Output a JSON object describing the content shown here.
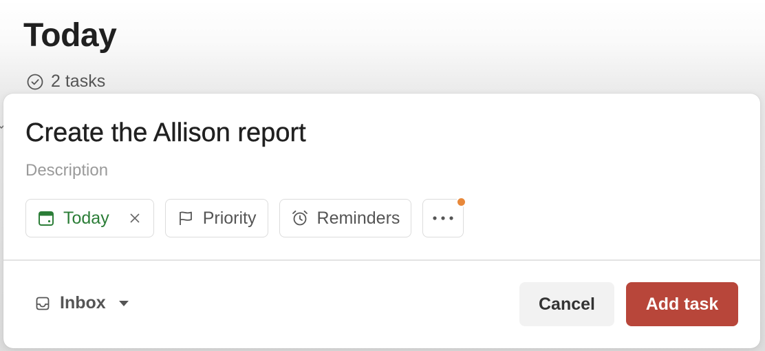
{
  "header": {
    "title": "Today",
    "task_count": "2 tasks"
  },
  "editor": {
    "task_name": "Create the Allison report",
    "description_placeholder": "Description",
    "chips": {
      "date": "Today",
      "priority": "Priority",
      "reminders": "Reminders"
    },
    "project": "Inbox",
    "cancel_label": "Cancel",
    "submit_label": "Add task"
  },
  "colors": {
    "accent": "#b8463a",
    "date_green": "#2b7d37",
    "badge_orange": "#e8883a"
  },
  "icons": {
    "task_count": "check-circle-icon",
    "date": "calendar-icon",
    "remove_date": "close-icon",
    "priority": "flag-icon",
    "reminders": "alarm-clock-icon",
    "more": "more-horizontal-icon",
    "project": "inbox-tray-icon",
    "project_caret": "caret-down-icon"
  }
}
